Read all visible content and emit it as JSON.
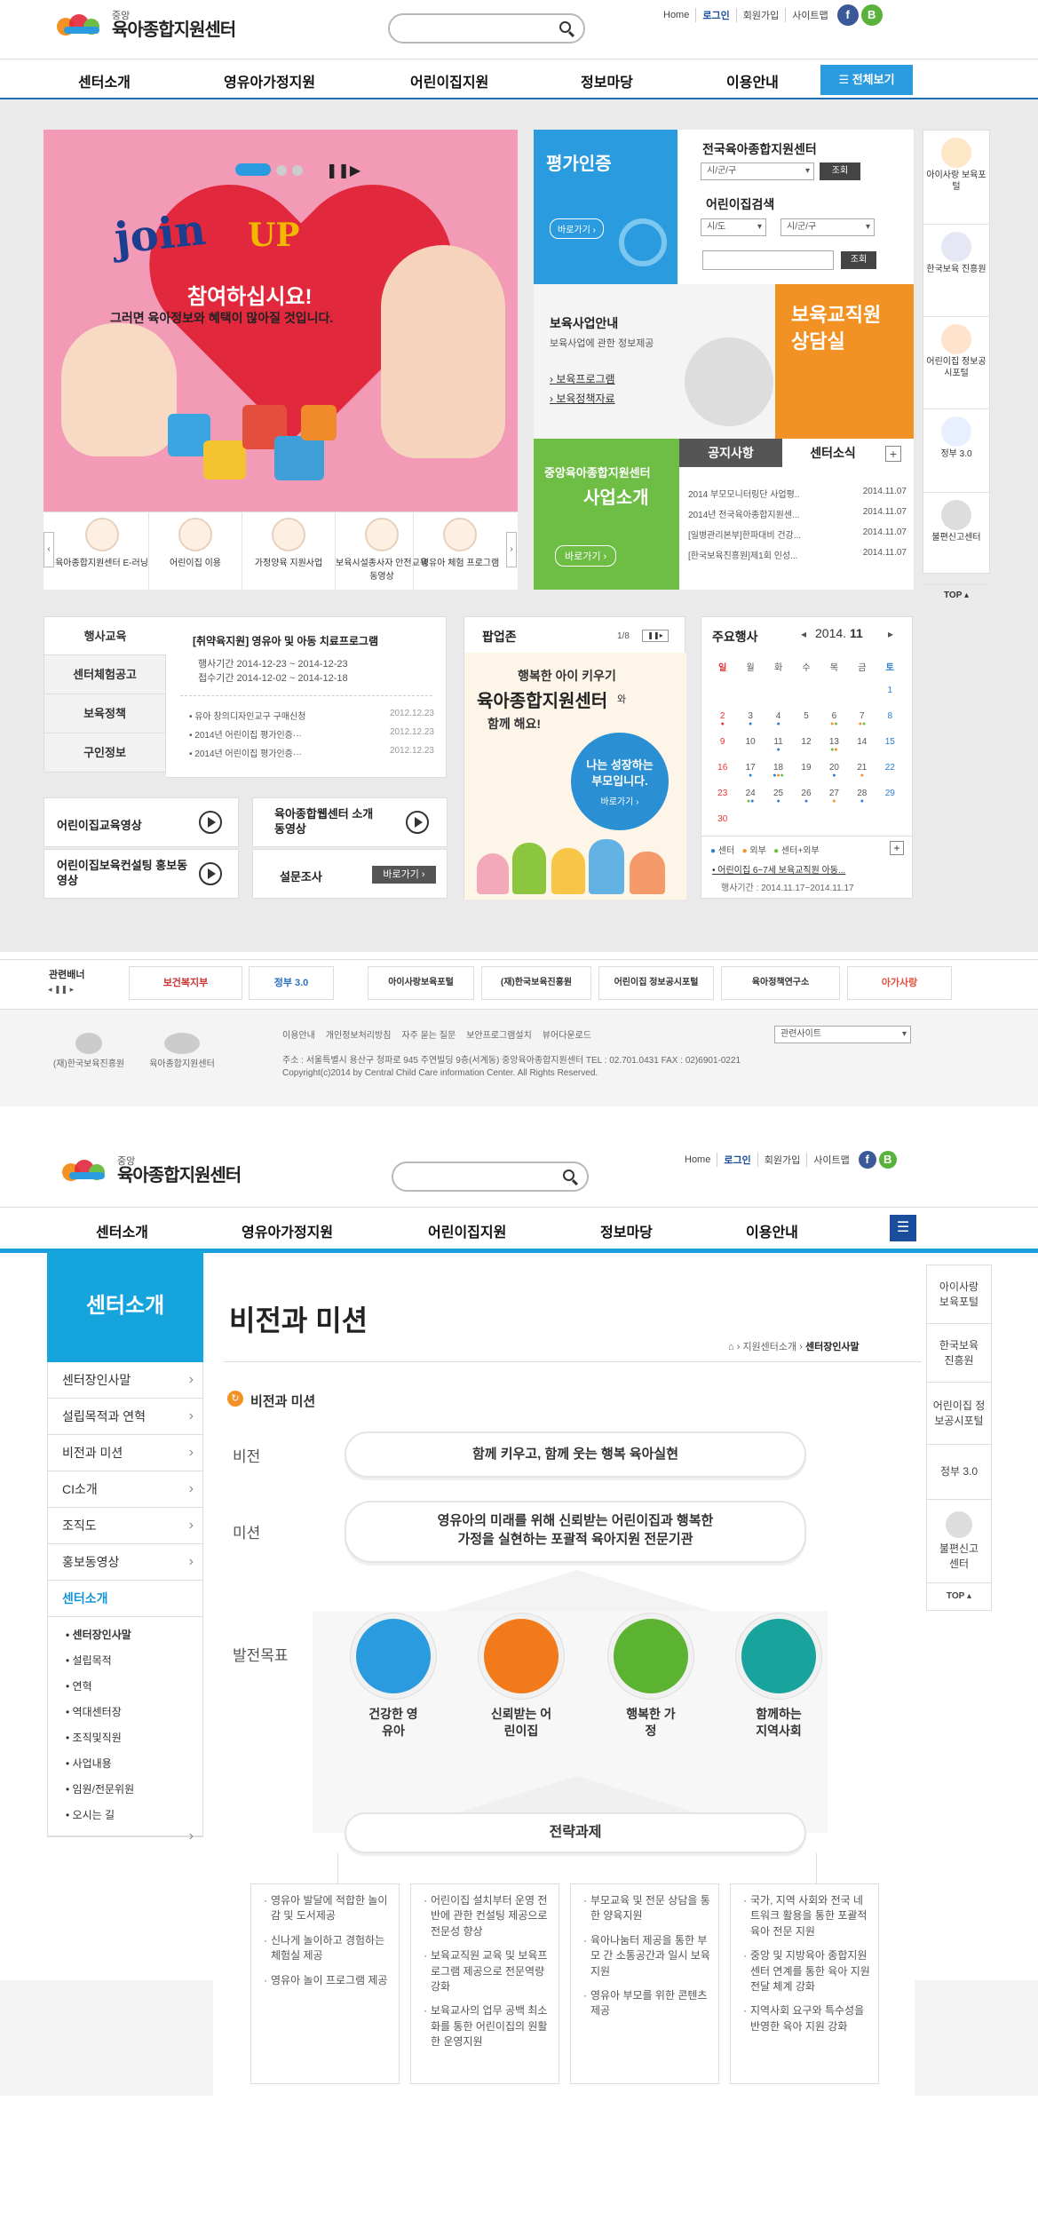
{
  "top": {
    "logo_small": "중앙",
    "logo_name": "육아종합지원센터",
    "util": [
      "Home",
      "로그인",
      "회원가입",
      "사이트맵"
    ],
    "sns": [
      "f",
      "B"
    ],
    "gnb": [
      "센터소개",
      "영유아가정지원",
      "어린이집지원",
      "정보마당",
      "이용안내"
    ],
    "all_label": "전체보기"
  },
  "banner": {
    "title_join": "join",
    "title_up": "UP",
    "headline": "참여하십시요!",
    "sub": "그러면 육아정보와 혜택이 많아질 것입니다."
  },
  "quick": [
    {
      "label": "육아종합지원센터 E-러닝"
    },
    {
      "label": "어린이집 이용"
    },
    {
      "label": "가정양육 지원사업"
    },
    {
      "label": "보육시설종사자 안전교육 동영상"
    },
    {
      "label": "영유아 체험 프로그램"
    }
  ],
  "eval": {
    "title": "평가인증",
    "go": "바로가기 ›"
  },
  "centerSearch": {
    "title": "전국육아종합지원센터",
    "sel1": "시/군/구",
    "btn": "조회",
    "title2": "어린이집검색",
    "sel2": "시/도",
    "sel3": "시/군/구",
    "btn2": "조회"
  },
  "support": {
    "title": "보육사업안내",
    "sub": "보육사업에 관한 정보제공",
    "items": [
      "보육프로그램",
      "보육정책자료"
    ]
  },
  "consult": {
    "title": "보육교직원 상담실"
  },
  "business": {
    "title": "중앙육아종합지원센터",
    "sub": "사업소개",
    "go": "바로가기 ›"
  },
  "notice": {
    "tab1": "공지사항",
    "tab2": "센터소식",
    "items": [
      {
        "t": "2014 부모모니터링단 사업평..",
        "d": "2014.11.07"
      },
      {
        "t": "2014년 전국육아종합지원센...",
        "d": "2014.11.07"
      },
      {
        "t": "[일병관리본부]한파대비 건강...",
        "d": "2014.11.07"
      },
      {
        "t": "[한국보육진흥원]제1회 인성...",
        "d": "2014.11.07"
      }
    ]
  },
  "rightSide": [
    {
      "label": "아이사랑 보육포털"
    },
    {
      "label": "한국보육 진흥원"
    },
    {
      "label": "어린이집 정보공시포털"
    },
    {
      "label": "정부 3.0"
    },
    {
      "label": "불편신고센터"
    }
  ],
  "top_btn": "TOP",
  "events": {
    "tabs": [
      "행사교육",
      "센터체험공고",
      "보육정책",
      "구인정보"
    ],
    "feature_title": "[취약육지원] 영유아 및 아동 치료프로그램",
    "period1": "행사기간 2014-12-23 ~ 2014-12-23",
    "period2": "접수기간 2014-12-02 ~ 2014-12-18",
    "list": [
      {
        "t": "유아 창의디자인교구 구매신청",
        "d": "2012.12.23"
      },
      {
        "t": "2014년 어린이집 평가인증···",
        "d": "2012.12.23"
      },
      {
        "t": "2014년 어린이집 평가인증···",
        "d": "2012.12.23"
      }
    ]
  },
  "popup": {
    "title": "팝업존",
    "page": "1/8",
    "l1": "행복한 아이 키우기",
    "l2": "육아종합지원센터",
    "l3": "와",
    "l4": "함께 해요!",
    "bubble": "나는 성장하는 부모입니다.",
    "go": "바로가기 ›"
  },
  "cal": {
    "title": "주요행사",
    "year": "2014.",
    "month": "11",
    "dow": [
      "일",
      "월",
      "화",
      "수",
      "목",
      "금",
      "토"
    ],
    "weeks": [
      [
        "",
        "",
        "",
        "",
        "",
        "",
        "1"
      ],
      [
        "2",
        "3",
        "4",
        "5",
        "6",
        "7",
        "8"
      ],
      [
        "9",
        "10",
        "11",
        "12",
        "13",
        "14",
        "15"
      ],
      [
        "16",
        "17",
        "18",
        "19",
        "20",
        "21",
        "22"
      ],
      [
        "23",
        "24",
        "25",
        "26",
        "27",
        "28",
        "29"
      ],
      [
        "30",
        "",
        "",
        "",
        "",
        "",
        ""
      ]
    ],
    "legend": [
      "센터",
      "외부",
      "센터+외부"
    ],
    "event_title": "어린이집 6~7세 보육교직원 아동...",
    "event_period": "행사기간 : 2014.11.17~2014.11.17"
  },
  "tiles": {
    "t1": "어린이집교육영상",
    "t2": "육아종합웹센터 소개동영상",
    "t3": "어린이집보육컨설팅 홍보동영상",
    "t4": "설문조사",
    "go": "바로가기 ›"
  },
  "partners": {
    "label": "관련배너",
    "items": [
      "보건복지부",
      "정부 3.0",
      "아이사랑보육포털",
      "(재)한국보육진흥원",
      "어린이집 정보공시포털",
      "육아정책연구소",
      "아가사랑"
    ]
  },
  "footer": {
    "links": [
      "이용안내",
      "개인정보처리방침",
      "자주 묻는 질문",
      "보안프로그램설치",
      "뷰어다운로드"
    ],
    "site_select": "관련사이트",
    "addr": "주소 : 서울특별시 용산구 청파로 945 주연빌딩 9층(서계동) 중앙육아종합지원센터   TEL : 02.701.0431   FAX : 02)6901-0221",
    "copy": "Copyright(c)2014 by Central Child Care information Center. All Rights Reserved.",
    "org1": "(재)한국보육진흥원",
    "org2": "육아종합지원센터"
  },
  "sub": {
    "lnb_title": "센터소개",
    "lnb": [
      "센터장인사말",
      "설립목적과 연혁",
      "비전과 미션",
      "CI소개",
      "조직도",
      "홍보동영상",
      "센터소개"
    ],
    "lnb_sub": [
      "센터장인사말",
      "설립목적",
      "연혁",
      "역대센터장",
      "조직및직원",
      "사업내용",
      "임원/전문위원",
      "오시는 길"
    ],
    "page_title": "비전과 미션",
    "crumb": [
      "지원센터소개",
      "센터장인사말"
    ],
    "section": "비전과 미션",
    "vision_label": "비전",
    "vision": "함께 키우고, 함께 웃는 행복 육아실현",
    "mission_label": "미션",
    "mission": "영유아의 미래를 위해 신뢰받는 어린이집과 행복한 가정을 실현하는 포괄적 육아지원 전문기관",
    "goal_label": "발전목표",
    "goals": [
      "건강한 영유아",
      "신뢰받는 어린이집",
      "행복한 가정",
      "함께하는 지역사회"
    ],
    "task_title": "전략과제",
    "tasks": [
      [
        "영유아 발달에 적합한 놀이감 및 도서제공",
        "신나게 놀이하고 경험하는 체험실 제공",
        "영유아 놀이 프로그램 제공"
      ],
      [
        "어린이집 설치부터 운영 전반에 관한 컨설팅 제공으로 전문성 향상",
        "보육교직원 교육 및 보육프로그램 제공으로 전문역량 강화",
        "보육교사의 업무 공백 최소화를 통한 어린이집의 원활한 운영지원"
      ],
      [
        "부모교육 및 전문 상담을 통한 양육지원",
        "육아나눔터 제공을 통한 부모 간 소통공간과 일시 보육지원",
        "영유아 부모를 위한 콘텐츠 제공"
      ],
      [
        "국가, 지역 사회와 전국 네트워크 활용을 통한 포괄적 육아 전문 지원",
        "중앙 및 지방육아 종합지원센터 연계를 통한 육아 지원 전달 체계 강화",
        "지역사회 요구와 특수성을 반영한 육아 지원 강화"
      ]
    ],
    "rightSide": [
      "아이사랑 보육포털",
      "한국보육 진흥원",
      "어린이집 정보공시포털",
      "정부 3.0",
      "불편신고 센터"
    ]
  },
  "colors": {
    "blue": "#2b9be0",
    "lnb": "#16a4dd",
    "orange": "#f39224",
    "green": "#6ebd45",
    "red": "#e2283c"
  }
}
